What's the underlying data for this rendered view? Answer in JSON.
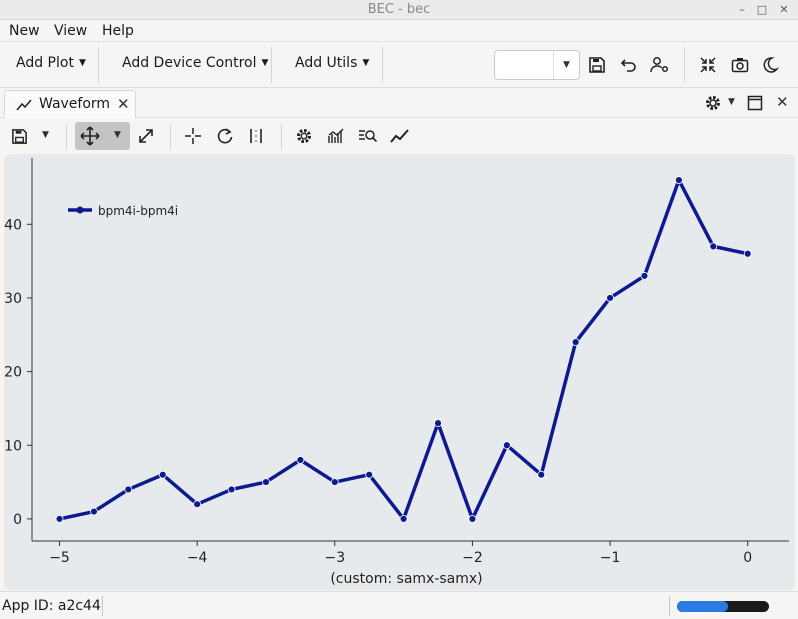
{
  "window": {
    "title": "BEC - bec",
    "controls": [
      "minimize",
      "maximize",
      "close"
    ]
  },
  "menubar": {
    "items": [
      "New",
      "View",
      "Help"
    ]
  },
  "toolbar": {
    "add_plot": "Add Plot",
    "add_device_control": "Add Device Control",
    "add_utils": "Add Utils",
    "combo_value": "",
    "icons": [
      "save-icon",
      "undo-icon",
      "user-settings-icon",
      "collapse-icon",
      "camera-icon",
      "dark-mode-icon"
    ]
  },
  "dock": {
    "tab_label": "Waveform",
    "tab_icon": "line-chart-icon"
  },
  "waveform_toolbar": {
    "icons": [
      "save-icon",
      "dropdown-icon",
      "pan-icon",
      "dropdown-icon",
      "zoom-expand-icon",
      "crosshair-icon",
      "reset-icon",
      "fit-icon",
      "settings-icon",
      "curve-settings-icon",
      "zoom-search-icon",
      "fit-line-icon"
    ]
  },
  "chart_data": {
    "type": "line",
    "title": "",
    "xlabel": "(custom: samx-samx)",
    "ylabel": "",
    "xlim": [
      -5.2,
      0.3
    ],
    "ylim": [
      -3,
      49
    ],
    "xticks": [
      -5,
      -4,
      -3,
      -2,
      -1,
      0
    ],
    "yticks": [
      0,
      10,
      20,
      30,
      40
    ],
    "legend_position": "top-left",
    "grid": false,
    "series": [
      {
        "name": "bpm4i-bpm4i",
        "color": "#0d1a8f",
        "x": [
          -5.0,
          -4.75,
          -4.5,
          -4.25,
          -4.0,
          -3.75,
          -3.5,
          -3.25,
          -3.0,
          -2.75,
          -2.5,
          -2.25,
          -2.0,
          -1.75,
          -1.5,
          -1.25,
          -1.0,
          -0.75,
          -0.5,
          -0.25,
          0.0
        ],
        "y": [
          0,
          1,
          4,
          6,
          2,
          4,
          5,
          8,
          5,
          6,
          0,
          13,
          0,
          10,
          6,
          24,
          30,
          33,
          46,
          37,
          36
        ]
      }
    ]
  },
  "status": {
    "app_id": "App ID: a2c44",
    "progress_fraction": 0.55
  },
  "colors": {
    "accent": "#2a7ae2",
    "series": "#0d1a8f",
    "plot_bg": "#e7eaed"
  }
}
